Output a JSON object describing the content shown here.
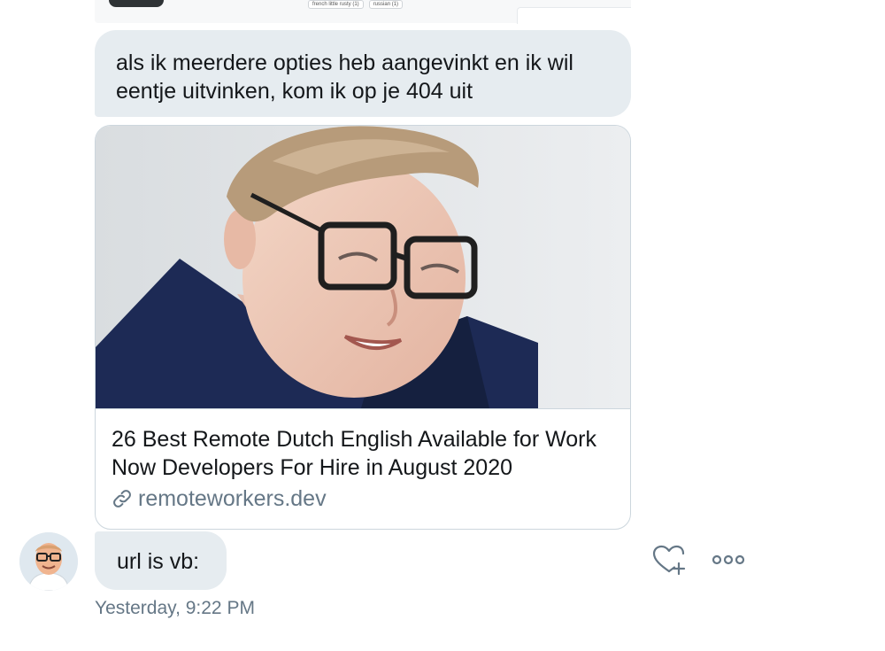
{
  "previous_message": {
    "tags": [
      "french little rusty (1)",
      "russian (1)"
    ]
  },
  "messages": {
    "text_1": "als ik meerdere opties heb aangevinkt en ik wil eentje uitvinken, kom ik op je 404 uit",
    "text_2": "url is vb:"
  },
  "link_card": {
    "title": "26 Best Remote Dutch English Available for Work Now Developers For Hire in August 2020",
    "domain": "remoteworkers.dev",
    "link_icon": "link-icon"
  },
  "actions": {
    "like_icon": "heart-plus-icon",
    "more_icon": "more-dots-icon"
  },
  "timestamp": "Yesterday, 9:22 PM",
  "colors": {
    "bubble": "#e6ecf0",
    "secondary_text": "#657786",
    "border": "#ccd6dd"
  }
}
